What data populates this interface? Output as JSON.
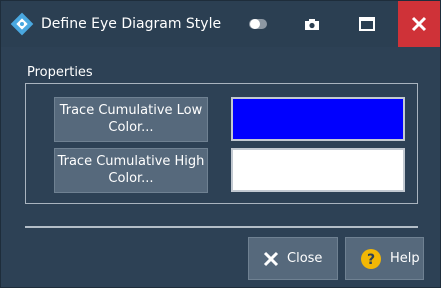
{
  "window": {
    "title": "Define Eye Diagram Style"
  },
  "properties": {
    "group_label": "Properties",
    "low": {
      "label": "Trace Cumulative Low Color...",
      "color": "#0000ff"
    },
    "high": {
      "label": "Trace Cumulative High Color...",
      "color": "#ffffff"
    }
  },
  "footer": {
    "close_label": "Close",
    "help_label": "Help"
  },
  "icons": {
    "app": "diamond-logo-icon",
    "toggle": "toggle-icon",
    "camera": "camera-icon",
    "maximize": "maximize-icon",
    "close": "close-icon",
    "close_button": "x-icon",
    "help_button": "question-circle-icon"
  },
  "colors": {
    "titlebar": "#2b3f52",
    "background": "#2d4155",
    "button": "#56697c",
    "close_accent": "#cf3238",
    "help_accent": "#f2b705"
  }
}
